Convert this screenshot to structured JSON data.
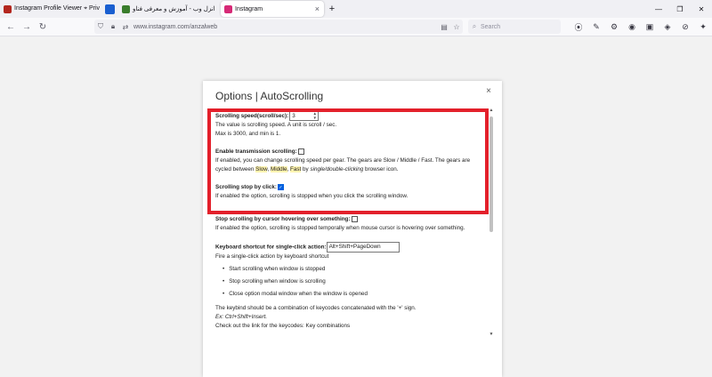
{
  "browser": {
    "tabs": [
      {
        "label": "Instagram Profile Viewer ⌖ Priv",
        "favicon_color": "#b3261e"
      },
      {
        "label": "",
        "favicon_color": "#1a5fd0"
      },
      {
        "label": "انزل وب - آموزش و معرفی فناو",
        "favicon_color": "#3a7d2c"
      },
      {
        "label": "Instagram",
        "favicon_color": "#d62976"
      }
    ],
    "new_tab_label": "+",
    "tab_close": "×",
    "window_controls": {
      "minimize": "—",
      "restore": "❐",
      "close": "✕"
    },
    "url": "www.instagram.com/anzalweb",
    "search_placeholder": "Search"
  },
  "modal": {
    "title": "Options | AutoScrolling",
    "close": "×",
    "scrolling_speed": {
      "label": "Scrolling speed(scroll/sec):",
      "value": "3",
      "help_1": "The value is scrolling speed. A unit is scroll / sec.",
      "help_2": "Max is 3000, and min is 1."
    },
    "transmission": {
      "label": "Enable transmission scrolling:",
      "checked": false,
      "help_a": "If enabled, you can change scrolling speed per gear. The gears are Slow / Middle / Fast. The gears are cycled between ",
      "slow": "Slow",
      "comma1": ", ",
      "middle": "Middle",
      "comma2": ", ",
      "fast": "Fast",
      "by": " by ",
      "clicking": "single/double-clicking",
      "help_b": " browser icon."
    },
    "stop_by_click": {
      "label": "Scrolling stop by click:",
      "checked": true,
      "help": "If enabled the option, scrolling is stopped when you click the scrolling window."
    },
    "stop_by_hover": {
      "label": "Stop scrolling by cursor hovering over something:",
      "checked": false,
      "help": "If enabled the option, scrolling is stopped temporally when mouse cursor is hovering over something."
    },
    "keyboard_shortcut": {
      "label": "Keyboard shortcut for single-click action:",
      "value": "Alt+Shift+PageDown",
      "help": "Fire a single-click action by keyboard shortcut",
      "items": [
        "Start scrolling when window is stopped",
        "Stop scrolling when window is scrolling",
        "Close option modal window when the window is opened"
      ],
      "keybind_note": "The keybind should be a combination of keycodes concatenated with the '+' sign.",
      "example": "Ex: Ctrl+Shift+Insert.",
      "link_note": "Check out the link for the keycodes: Key combinations"
    }
  },
  "colors": {
    "highlight_frame": "#e3202b",
    "checkbox_checked": "#0060df"
  }
}
